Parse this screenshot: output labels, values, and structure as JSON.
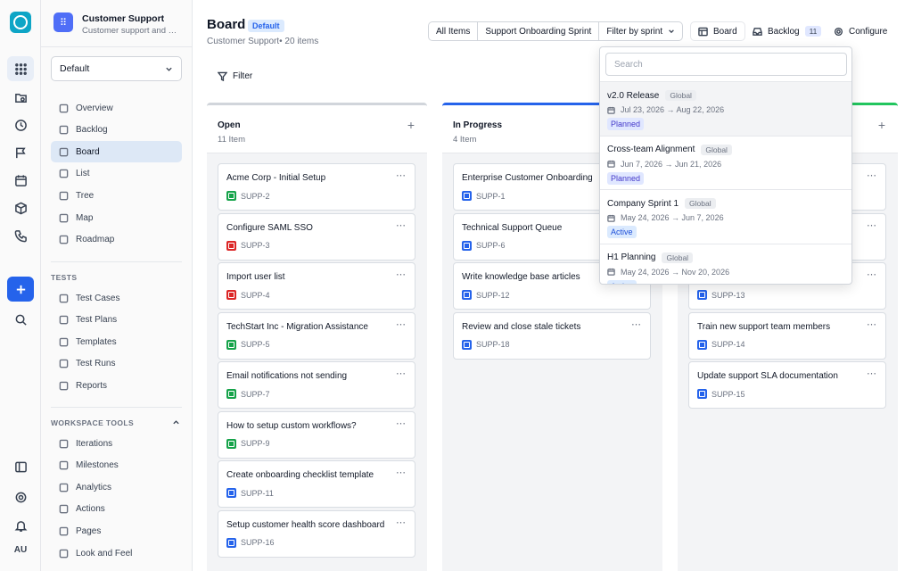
{
  "sidebar": {
    "project_title": "Customer Support",
    "project_subtitle": "Customer support and s...",
    "workspace_select": "Default",
    "nav": [
      {
        "label": "Overview",
        "icon": "home-icon"
      },
      {
        "label": "Backlog",
        "icon": "backlog-icon"
      },
      {
        "label": "Board",
        "icon": "board-icon",
        "active": true
      },
      {
        "label": "List",
        "icon": "list-icon"
      },
      {
        "label": "Tree",
        "icon": "tree-icon"
      },
      {
        "label": "Map",
        "icon": "map-pin-icon"
      },
      {
        "label": "Roadmap",
        "icon": "roadmap-icon"
      }
    ],
    "tests_heading": "TESTS",
    "tests": [
      {
        "label": "Test Cases",
        "icon": "file-icon"
      },
      {
        "label": "Test Plans",
        "icon": "cube-icon"
      },
      {
        "label": "Templates",
        "icon": "template-icon"
      },
      {
        "label": "Test Runs",
        "icon": "play-icon"
      },
      {
        "label": "Reports",
        "icon": "bar-chart-icon"
      }
    ],
    "tools_heading": "WORKSPACE TOOLS",
    "tools": [
      {
        "label": "Iterations",
        "icon": "iterations-icon"
      },
      {
        "label": "Milestones",
        "icon": "flag-icon"
      },
      {
        "label": "Analytics",
        "icon": "trend-icon"
      },
      {
        "label": "Actions",
        "icon": "bolt-icon"
      },
      {
        "label": "Pages",
        "icon": "pages-icon"
      },
      {
        "label": "Look and Feel",
        "icon": "palette-icon"
      }
    ]
  },
  "rail": {
    "user_initials": "AU"
  },
  "header": {
    "title": "Board",
    "badge": "Default",
    "subtitle": "Customer Support• 20 items",
    "tabs": [
      "All Items",
      "Support Onboarding Sprint",
      "Filter by sprint"
    ],
    "board_label": "Board",
    "backlog_label": "Backlog",
    "backlog_count": "11",
    "configure_label": "Configure",
    "filter_label": "Filter"
  },
  "columns": [
    {
      "name": "Open",
      "count": "11 Item",
      "accent": "#d1d5db",
      "cards": [
        {
          "title": "Acme Corp - Initial Setup",
          "id": "SUPP-2",
          "type": "story"
        },
        {
          "title": "Configure SAML SSO",
          "id": "SUPP-3",
          "type": "bug"
        },
        {
          "title": "Import user list",
          "id": "SUPP-4",
          "type": "bug"
        },
        {
          "title": "TechStart Inc - Migration Assistance",
          "id": "SUPP-5",
          "type": "story"
        },
        {
          "title": "Email notifications not sending",
          "id": "SUPP-7",
          "type": "story"
        },
        {
          "title": "How to setup custom workflows?",
          "id": "SUPP-9",
          "type": "story"
        },
        {
          "title": "Create onboarding checklist template",
          "id": "SUPP-11",
          "type": "task"
        },
        {
          "title": "Setup customer health score dashboard",
          "id": "SUPP-16",
          "type": "task"
        }
      ]
    },
    {
      "name": "In Progress",
      "count": "4 Item",
      "accent": "#2563eb",
      "cards": [
        {
          "title": "Enterprise Customer Onboarding",
          "id": "SUPP-1",
          "type": "task"
        },
        {
          "title": "Technical Support Queue",
          "id": "SUPP-6",
          "type": "task"
        },
        {
          "title": "Write knowledge base articles",
          "id": "SUPP-12",
          "type": "task"
        },
        {
          "title": "Review and close stale tickets",
          "id": "SUPP-18",
          "type": "task"
        }
      ]
    },
    {
      "name": "",
      "count": "",
      "accent": "#22c55e",
      "cards": [
        {
          "title": "",
          "id": "",
          "type": "task"
        },
        {
          "title": "",
          "id": "",
          "type": "task"
        },
        {
          "title": "",
          "id": "SUPP-13",
          "type": "task"
        },
        {
          "title": "Train new support team members",
          "id": "SUPP-14",
          "type": "task"
        },
        {
          "title": "Update support SLA documentation",
          "id": "SUPP-15",
          "type": "task"
        }
      ]
    }
  ],
  "sprint_dropdown": {
    "search_placeholder": "Search",
    "items": [
      {
        "name": "v2.0 Release",
        "scope": "Global",
        "dates": "Jul 23, 2026 → Aug 22, 2026",
        "status": "Planned"
      },
      {
        "name": "Cross-team Alignment",
        "scope": "Global",
        "dates": "Jun 7, 2026 → Jun 21, 2026",
        "status": "Planned"
      },
      {
        "name": "Company Sprint 1",
        "scope": "Global",
        "dates": "May 24, 2026 → Jun 7, 2026",
        "status": "Active"
      },
      {
        "name": "H1 Planning",
        "scope": "Global",
        "dates": "May 24, 2026 → Nov 20, 2026",
        "status": "Active"
      }
    ]
  }
}
